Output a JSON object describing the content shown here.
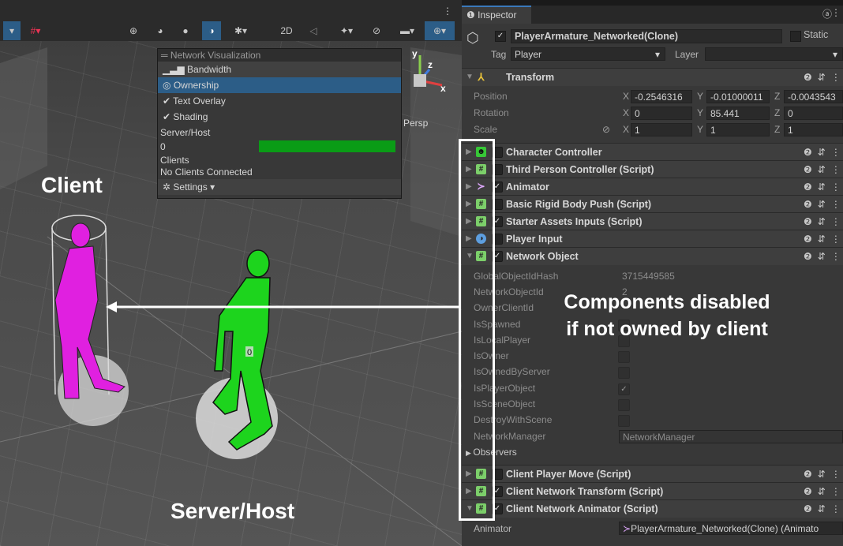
{
  "scene": {
    "toolbar_buttons": [
      "2D"
    ],
    "persp_label": "Persp",
    "axis_labels": {
      "y": "y",
      "z": "z",
      "x": "x"
    },
    "gizmo_value": "0"
  },
  "network_visualization": {
    "title": "Network Visualization",
    "items": [
      {
        "label": "Bandwidth",
        "icon": "bandwidth-icon",
        "selected": false
      },
      {
        "label": "Ownership",
        "icon": "ownership-icon",
        "selected": true
      },
      {
        "label": "Text Overlay",
        "icon": "check-icon",
        "selected": false
      },
      {
        "label": "Shading",
        "icon": "check-icon",
        "selected": false
      }
    ],
    "server_host_label": "Server/Host",
    "server_host_value": "0",
    "server_bar_fraction": 1.0,
    "clients_label": "Clients",
    "clients_value": "No Clients Connected",
    "settings_label": "Settings"
  },
  "annotations": {
    "client_label": "Client",
    "server_label": "Server/Host",
    "callout_line1": "Components disabled",
    "callout_line2": "if not owned by client"
  },
  "inspector": {
    "tab_label": "Inspector",
    "object_name": "PlayerArmature_Networked(Clone)",
    "static_label": "Static",
    "tag_label": "Tag",
    "tag_value": "Player",
    "layer_label": "Layer",
    "layer_value": "",
    "transform": {
      "title": "Transform",
      "rows": [
        {
          "label": "Position",
          "x": "-0.2546316",
          "y": "-0.01000011",
          "z": "-0.0043543"
        },
        {
          "label": "Rotation",
          "x": "0",
          "y": "85.441",
          "z": "0"
        },
        {
          "label": "Scale",
          "x": "1",
          "y": "1",
          "z": "1"
        }
      ]
    },
    "components_top": [
      {
        "name": "Character Controller",
        "icon": "character-controller-icon",
        "checked": false
      },
      {
        "name": "Third Person Controller (Script)",
        "icon": "script-icon",
        "checked": false
      },
      {
        "name": "Animator",
        "icon": "animator-icon",
        "checked": true
      },
      {
        "name": "Basic Rigid Body Push (Script)",
        "icon": "script-icon",
        "checked": false
      },
      {
        "name": "Starter Assets Inputs (Script)",
        "icon": "script-icon",
        "checked": true
      },
      {
        "name": "Player Input",
        "icon": "player-input-icon",
        "checked": false
      },
      {
        "name": "Network Object",
        "icon": "script-icon",
        "checked": true
      }
    ],
    "network_object_props": [
      {
        "label": "GlobalObjectIdHash",
        "value": "3715449585"
      },
      {
        "label": "NetworkObjectId",
        "value": "2"
      },
      {
        "label": "OwnerClientId",
        "value": ""
      },
      {
        "label": "IsSpawned",
        "value": ""
      },
      {
        "label": "IsLocalPlayer",
        "value": ""
      },
      {
        "label": "IsOwner",
        "value": ""
      },
      {
        "label": "IsOwnedByServer",
        "value": ""
      },
      {
        "label": "IsPlayerObject",
        "value": "✓"
      },
      {
        "label": "IsSceneObject",
        "value": ""
      },
      {
        "label": "DestroyWithScene",
        "value": ""
      },
      {
        "label": "NetworkManager",
        "value": "NetworkManager"
      }
    ],
    "observers_label": "Observers",
    "components_bottom": [
      {
        "name": "Client Player Move (Script)",
        "icon": "script-icon",
        "checked": false
      },
      {
        "name": "Client Network Transform (Script)",
        "icon": "script-icon",
        "checked": true
      },
      {
        "name": "Client Network Animator (Script)",
        "icon": "script-icon",
        "checked": true
      }
    ],
    "animator_label": "Animator",
    "animator_value": "PlayerArmature_Networked(Clone) (Animato"
  }
}
